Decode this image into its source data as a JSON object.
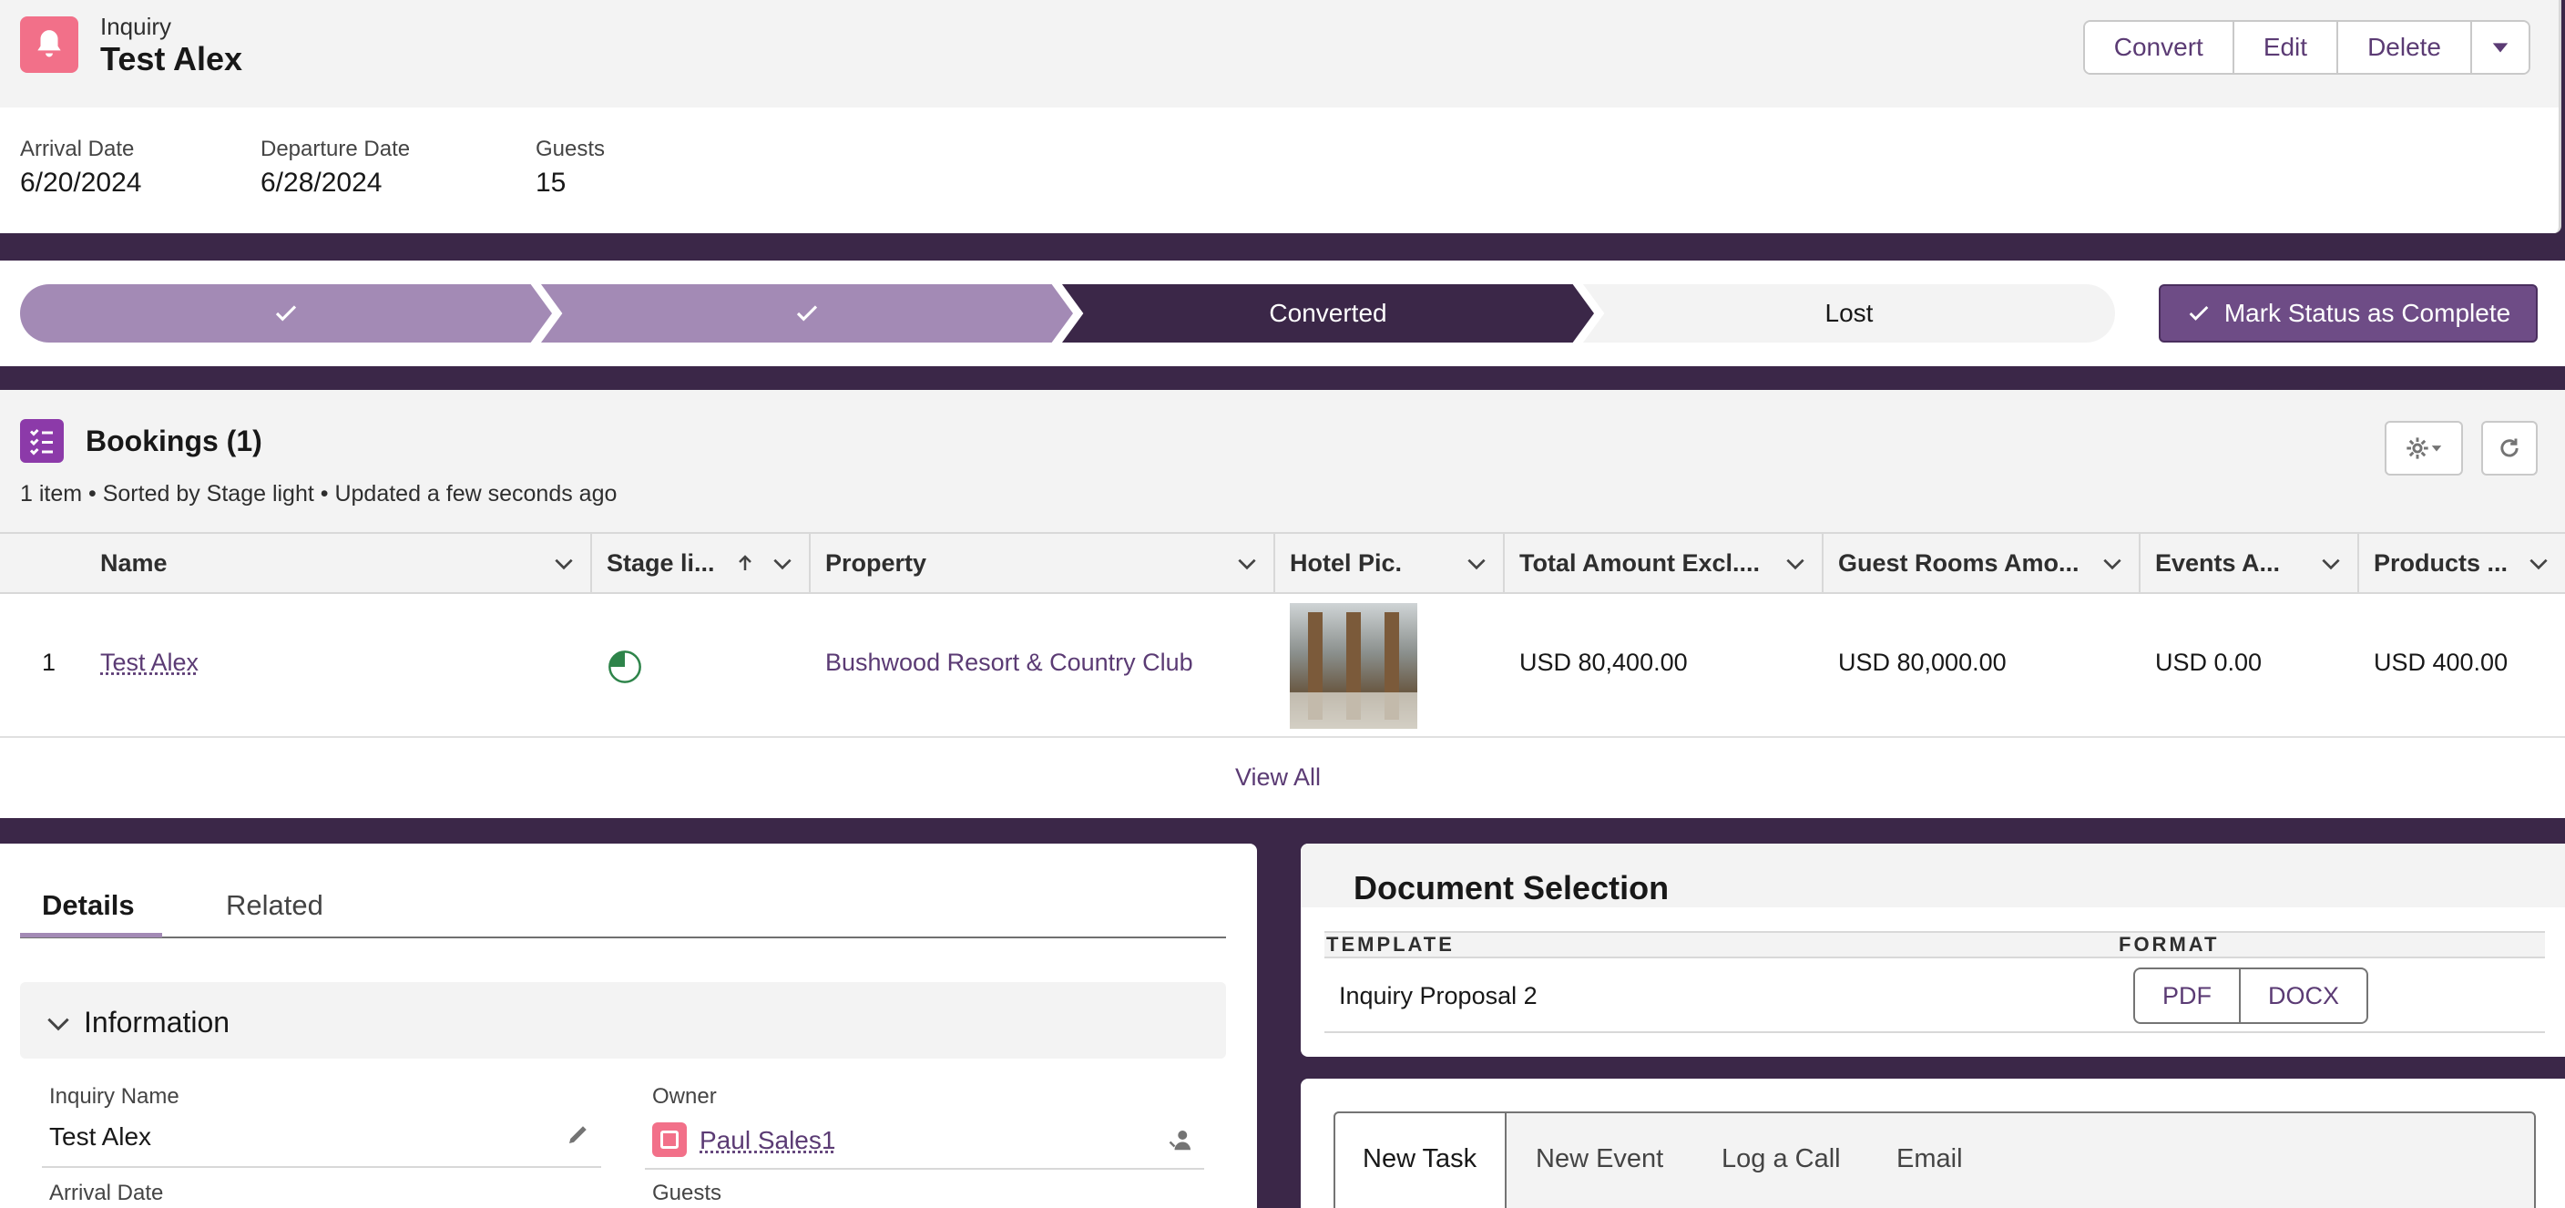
{
  "header": {
    "record_type": "Inquiry",
    "title": "Test Alex",
    "actions": [
      "Convert",
      "Edit",
      "Delete"
    ],
    "highlights": [
      {
        "label": "Arrival Date",
        "value": "6/20/2024"
      },
      {
        "label": "Departure Date",
        "value": "6/28/2024"
      },
      {
        "label": "Guests",
        "value": "15"
      }
    ]
  },
  "path": {
    "stages": [
      {
        "label": "",
        "state": "complete"
      },
      {
        "label": "",
        "state": "complete"
      },
      {
        "label": "Converted",
        "state": "current"
      },
      {
        "label": "Lost",
        "state": "incomplete"
      }
    ],
    "mark_complete_label": "Mark Status as Complete"
  },
  "bookings": {
    "title": "Bookings (1)",
    "subtitle": "1 item • Sorted by Stage light • Updated a few seconds ago",
    "columns": [
      "Name",
      "Stage li...",
      "Property",
      "Hotel Pic.",
      "Total Amount Excl....",
      "Guest Rooms Amo...",
      "Events A...",
      "Products ..."
    ],
    "rows": [
      {
        "index": "1",
        "name": "Test Alex",
        "property": "Bushwood Resort & Country Club",
        "total_amount": "USD 80,400.00",
        "guest_rooms_amount": "USD 80,000.00",
        "events_amount": "USD 0.00",
        "products_amount": "USD 400.00"
      }
    ],
    "view_all": "View All"
  },
  "details": {
    "tabs": [
      "Details",
      "Related"
    ],
    "section_title": "Information",
    "fields": {
      "inquiry_name_label": "Inquiry Name",
      "inquiry_name_value": "Test Alex",
      "owner_label": "Owner",
      "owner_value": "Paul Sales1",
      "arrival_label": "Arrival Date",
      "guests_label": "Guests"
    }
  },
  "document_selection": {
    "title": "Document Selection",
    "col_template": "TEMPLATE",
    "col_format": "FORMAT",
    "template_name": "Inquiry Proposal 2",
    "formats": [
      "PDF",
      "DOCX"
    ]
  },
  "activity": {
    "tabs": [
      "New Task",
      "New Event",
      "Log a Call",
      "Email"
    ]
  },
  "colors": {
    "brand": "#3b2748",
    "path_complete": "#a38ab5",
    "path_current": "#3b2748",
    "accent_button": "#6e4c86",
    "link": "#5b3b74",
    "inquiry_icon": "#f27089",
    "bookings_icon": "#8c3aa9"
  }
}
